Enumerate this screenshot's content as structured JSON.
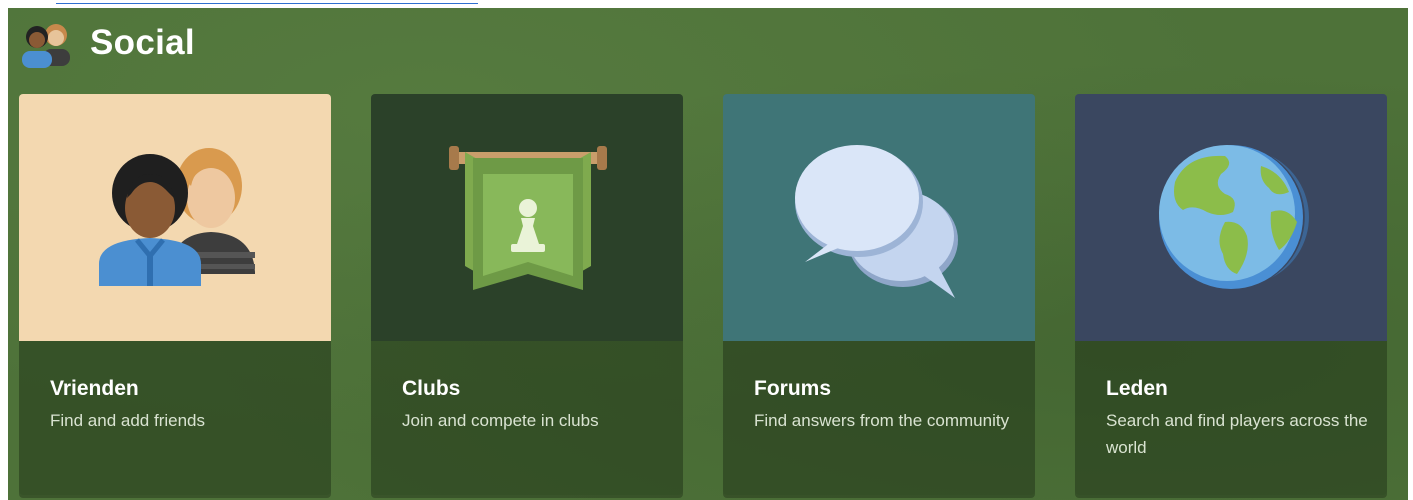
{
  "header": {
    "title": "Social",
    "icon": "friends-icon"
  },
  "cards": [
    {
      "title": "Vrienden",
      "description": "Find and add friends",
      "icon": "friends-icon",
      "art_color": "#f3d8b0"
    },
    {
      "title": "Clubs",
      "description": "Join and compete in clubs",
      "icon": "club-banner-icon",
      "art_color": "#2b4129"
    },
    {
      "title": "Forums",
      "description": "Find answers from the community",
      "icon": "chat-bubbles-icon",
      "art_color": "#3f7577"
    },
    {
      "title": "Leden",
      "description": "Search and find players across the world",
      "icon": "globe-icon",
      "art_color": "#3a4760"
    }
  ],
  "colors": {
    "background": "#4e7239",
    "info_panel": "#2e4824",
    "text": "#ffffff",
    "subtext": "#d9e3d1"
  }
}
